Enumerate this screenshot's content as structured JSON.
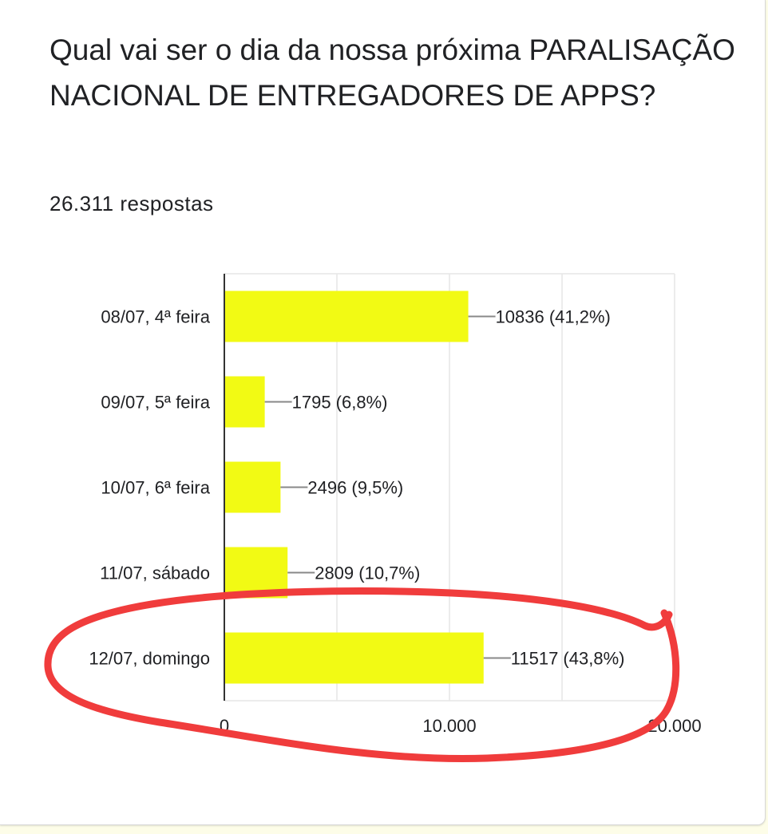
{
  "question": "Qual vai ser o dia da nossa próxima PARALISAÇÃO NACIONAL DE ENTREGADORES DE APPS?",
  "responses_label": "26.311 respostas",
  "colors": {
    "bar": "#f2fa14",
    "annotation": "#f03c3c",
    "grid": "#e6e6e6",
    "axis": "#333333",
    "leader": "#888888"
  },
  "annotation": {
    "shape": "hand-drawn-ellipse",
    "encircles": "12/07, domingo"
  },
  "chart_data": {
    "type": "bar",
    "orientation": "horizontal",
    "categories": [
      "08/07, 4ª feira",
      "09/07, 5ª feira",
      "10/07, 6ª feira",
      "11/07, sábado",
      "12/07, domingo"
    ],
    "values": [
      10836,
      1795,
      2496,
      2809,
      11517
    ],
    "data_labels": [
      "10836 (41,2%)",
      "1795 (6,8%)",
      "2496 (9,5%)",
      "2809 (10,7%)",
      "11517 (43,8%)"
    ],
    "xlim": [
      0,
      20000
    ],
    "x_ticks": [
      0,
      10000,
      20000
    ],
    "x_tick_labels": [
      "0",
      "10.000",
      "20.000"
    ],
    "grid": true,
    "legend": "none"
  }
}
